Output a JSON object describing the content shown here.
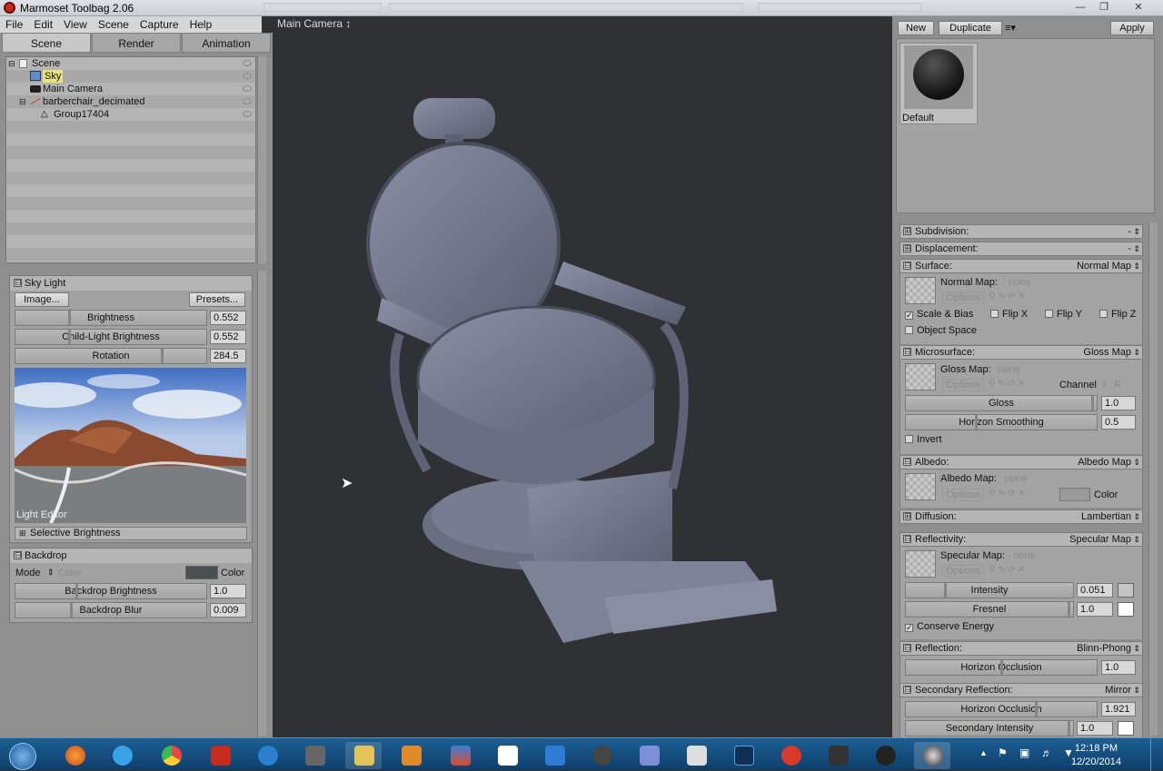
{
  "window": {
    "title": "Marmoset Toolbag 2.06"
  },
  "menu": [
    "File",
    "Edit",
    "View",
    "Scene",
    "Capture",
    "Help"
  ],
  "tabs": [
    "Scene",
    "Render",
    "Animation"
  ],
  "tree": [
    {
      "label": "Scene",
      "indent": 0
    },
    {
      "label": "Sky",
      "indent": 1
    },
    {
      "label": "Main Camera",
      "indent": 1
    },
    {
      "label": "barberchair_decimated",
      "indent": 1
    },
    {
      "label": "Group17404",
      "indent": 2
    }
  ],
  "skylight": {
    "title": "Sky Light",
    "image_btn": "Image...",
    "presets_btn": "Presets...",
    "brightness_label": "Brightness",
    "brightness": "0.552",
    "child_label": "Child-Light Brightness",
    "child": "0.552",
    "rotation_label": "Rotation",
    "rotation": "284.5",
    "light_editor": "Light Editor",
    "selective": "Selective Brightness"
  },
  "backdrop": {
    "title": "Backdrop",
    "mode_label": "Mode",
    "mode_value": "Color",
    "color_label": "Color",
    "brightness_label": "Backdrop Brightness",
    "brightness": "1.0",
    "blur_label": "Backdrop Blur",
    "blur": "0.009"
  },
  "viewport": {
    "camera": "Main Camera ↕"
  },
  "material": {
    "new": "New",
    "duplicate": "Duplicate",
    "apply": "Apply",
    "name": "Default"
  },
  "rsections": {
    "subdivision": {
      "label": "Subdivision:",
      "value": "-"
    },
    "displacement": {
      "label": "Displacement:",
      "value": "-"
    },
    "surface": {
      "label": "Surface:",
      "value": "Normal Map"
    },
    "microsurface": {
      "label": "Microsurface:",
      "value": "Gloss Map"
    },
    "albedo": {
      "label": "Albedo:",
      "value": "Albedo Map"
    },
    "diffusion": {
      "label": "Diffusion:",
      "value": "Lambertian"
    },
    "reflectivity": {
      "label": "Reflectivity:",
      "value": "Specular Map"
    },
    "reflection": {
      "label": "Reflection:",
      "value": "Blinn-Phong"
    },
    "secondary": {
      "label": "Secondary Reflection:",
      "value": "Mirror"
    }
  },
  "surface": {
    "map_label": "Normal Map:",
    "map_value": "none",
    "options": "Options",
    "scale_bias": "Scale & Bias",
    "flipx": "Flip X",
    "flipy": "Flip Y",
    "flipz": "Flip Z",
    "object_space": "Object Space"
  },
  "micro": {
    "map_label": "Gloss Map:",
    "map_value": "none",
    "options": "Options",
    "channel_label": "Channel",
    "channel": "R",
    "gloss_label": "Gloss",
    "gloss": "1.0",
    "horizon_label": "Horizon Smoothing",
    "horizon": "0.5",
    "invert": "Invert"
  },
  "albedo": {
    "map_label": "Albedo Map:",
    "map_value": "none",
    "options": "Options",
    "color": "Color"
  },
  "reflect": {
    "map_label": "Specular Map:",
    "map_value": "none",
    "options": "Options",
    "intensity_label": "Intensity",
    "intensity": "0.051",
    "fresnel_label": "Fresnel",
    "fresnel": "1.0",
    "conserve": "Conserve Energy"
  },
  "reflection": {
    "horizon_label": "Horizon Occlusion",
    "horizon": "1.0"
  },
  "secondary": {
    "horizon_label": "Horizon Occlusion",
    "horizon": "1.921",
    "intensity_label": "Secondary Intensity",
    "intensity": "1.0"
  },
  "clock": {
    "time": "12:18 PM",
    "date": "12/20/2014"
  },
  "taskbar_apps": [
    "start",
    "firefox",
    "ie",
    "chrome",
    "filezilla",
    "app5",
    "gimp",
    "explorer",
    "media",
    "app9",
    "dropbox",
    "xn",
    "gimp2",
    "app13",
    "zbrush",
    "photoshop",
    "substance",
    "app17",
    "app18",
    "app19"
  ],
  "colors": {
    "accent": "#1d5f93",
    "chair": "#6e7388"
  }
}
